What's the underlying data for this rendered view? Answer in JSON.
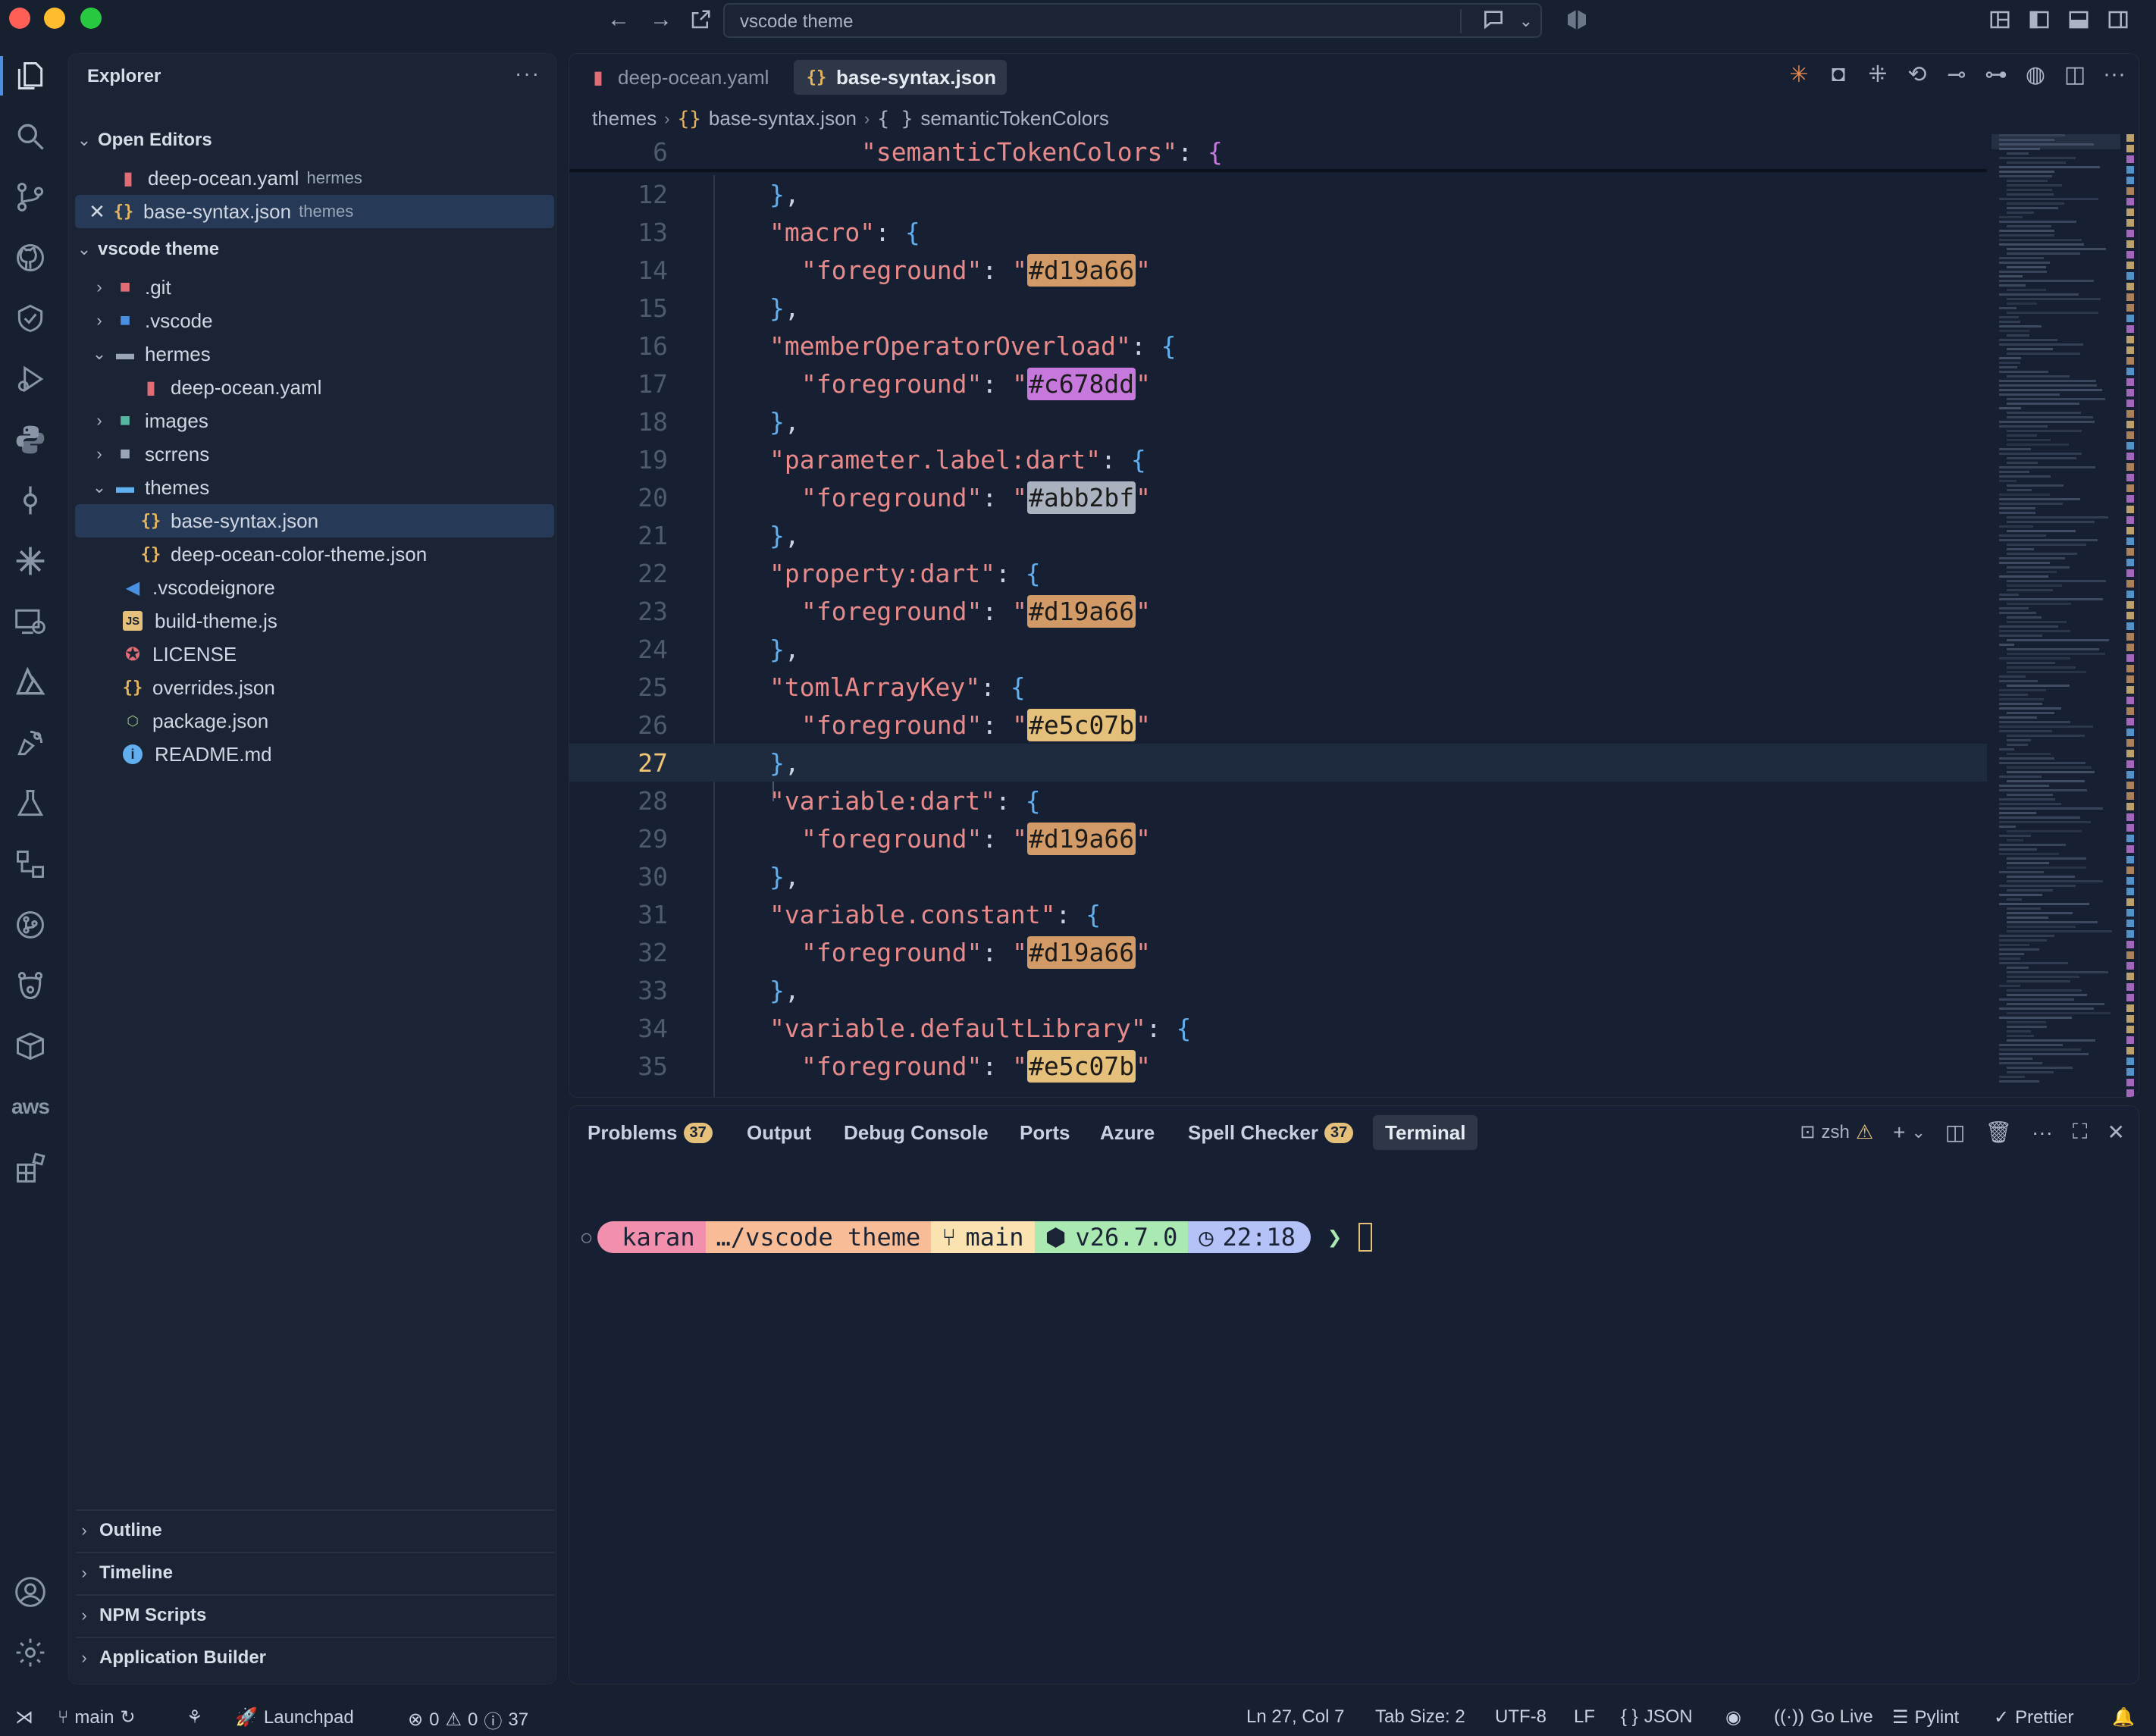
{
  "titlebar": {
    "search_text": "vscode theme",
    "colors": {
      "close": "#ff5f57",
      "minimize": "#febc2e",
      "zoom": "#28c840"
    }
  },
  "sidebar": {
    "title": "Explorer",
    "open_editors_label": "Open Editors",
    "open_editors": [
      {
        "name": "deep-ocean.yaml",
        "hint": "hermes",
        "icon": "yaml-file-icon"
      },
      {
        "name": "base-syntax.json",
        "hint": "themes",
        "icon": "json-file-icon"
      }
    ],
    "project_label": "vscode theme",
    "tree": [
      {
        "name": ".git"
      },
      {
        "name": ".vscode"
      },
      {
        "name": "hermes"
      },
      {
        "name": "deep-ocean.yaml"
      },
      {
        "name": "images"
      },
      {
        "name": "scrrens"
      },
      {
        "name": "themes"
      },
      {
        "name": "base-syntax.json"
      },
      {
        "name": "deep-ocean-color-theme.json"
      },
      {
        "name": ".vscodeignore"
      },
      {
        "name": "build-theme.js"
      },
      {
        "name": "LICENSE"
      },
      {
        "name": "overrides.json"
      },
      {
        "name": "package.json"
      },
      {
        "name": "README.md"
      }
    ],
    "bottom_sections": [
      "Outline",
      "Timeline",
      "NPM Scripts",
      "Application Builder"
    ]
  },
  "editor": {
    "tabs": [
      {
        "label": "deep-ocean.yaml",
        "active": false
      },
      {
        "label": "base-syntax.json",
        "active": true
      }
    ],
    "breadcrumb": [
      "themes",
      "base-syntax.json",
      "semanticTokenColors"
    ],
    "breadcrumb_icons": [
      "{}",
      "{ }"
    ],
    "sticky_line": {
      "number": "6",
      "text": "\"semanticTokenColors\": {"
    },
    "current_line": "27",
    "lines": [
      {
        "n": "12",
        "indent": 1,
        "kind": "close",
        "text": "},"
      },
      {
        "n": "13",
        "indent": 1,
        "kind": "open",
        "key": "\"macro\""
      },
      {
        "n": "14",
        "indent": 2,
        "kind": "fg",
        "value": "#d19a66"
      },
      {
        "n": "15",
        "indent": 1,
        "kind": "close",
        "text": "},"
      },
      {
        "n": "16",
        "indent": 1,
        "kind": "open",
        "key": "\"memberOperatorOverload\""
      },
      {
        "n": "17",
        "indent": 2,
        "kind": "fg",
        "value": "#c678dd"
      },
      {
        "n": "18",
        "indent": 1,
        "kind": "close",
        "text": "},"
      },
      {
        "n": "19",
        "indent": 1,
        "kind": "open",
        "key": "\"parameter.label:dart\""
      },
      {
        "n": "20",
        "indent": 2,
        "kind": "fg",
        "value": "#abb2bf"
      },
      {
        "n": "21",
        "indent": 1,
        "kind": "close",
        "text": "},"
      },
      {
        "n": "22",
        "indent": 1,
        "kind": "open",
        "key": "\"property:dart\""
      },
      {
        "n": "23",
        "indent": 2,
        "kind": "fg",
        "value": "#d19a66"
      },
      {
        "n": "24",
        "indent": 1,
        "kind": "close",
        "text": "},"
      },
      {
        "n": "25",
        "indent": 1,
        "kind": "open",
        "key": "\"tomlArrayKey\""
      },
      {
        "n": "26",
        "indent": 2,
        "kind": "fg",
        "value": "#e5c07b"
      },
      {
        "n": "27",
        "indent": 1,
        "kind": "close",
        "text": "},"
      },
      {
        "n": "28",
        "indent": 1,
        "kind": "open",
        "key": "\"variable:dart\""
      },
      {
        "n": "29",
        "indent": 2,
        "kind": "fg",
        "value": "#d19a66"
      },
      {
        "n": "30",
        "indent": 1,
        "kind": "close",
        "text": "},"
      },
      {
        "n": "31",
        "indent": 1,
        "kind": "open",
        "key": "\"variable.constant\""
      },
      {
        "n": "32",
        "indent": 2,
        "kind": "fg",
        "value": "#d19a66"
      },
      {
        "n": "33",
        "indent": 1,
        "kind": "close",
        "text": "},"
      },
      {
        "n": "34",
        "indent": 1,
        "kind": "open",
        "key": "\"variable.defaultLibrary\""
      },
      {
        "n": "35",
        "indent": 2,
        "kind": "fg",
        "value": "#e5c07b"
      }
    ],
    "fg_key": "\"foreground\""
  },
  "panel": {
    "tabs": [
      {
        "label": "Problems",
        "badge": "37"
      },
      {
        "label": "Output"
      },
      {
        "label": "Debug Console"
      },
      {
        "label": "Ports"
      },
      {
        "label": "Azure"
      },
      {
        "label": "Spell Checker",
        "badge": "37"
      },
      {
        "label": "Terminal",
        "active": true
      }
    ],
    "shell_label": "zsh",
    "prompt": {
      "user": "karan",
      "path": "…/vscode theme",
      "branch": "main",
      "node": "v26.7.0",
      "time": "22:18",
      "arrow": "❯"
    }
  },
  "statusbar": {
    "branch": "main",
    "launchpad": "Launchpad",
    "errors": "0",
    "warnings": "0",
    "infos": "37",
    "position": "Ln 27, Col 7",
    "tab_size": "Tab Size: 2",
    "encoding": "UTF-8",
    "eol": "LF",
    "language": "JSON",
    "language_icon": "{ }",
    "go_live": "Go Live",
    "pylint": "Pylint",
    "prettier": "Prettier"
  }
}
